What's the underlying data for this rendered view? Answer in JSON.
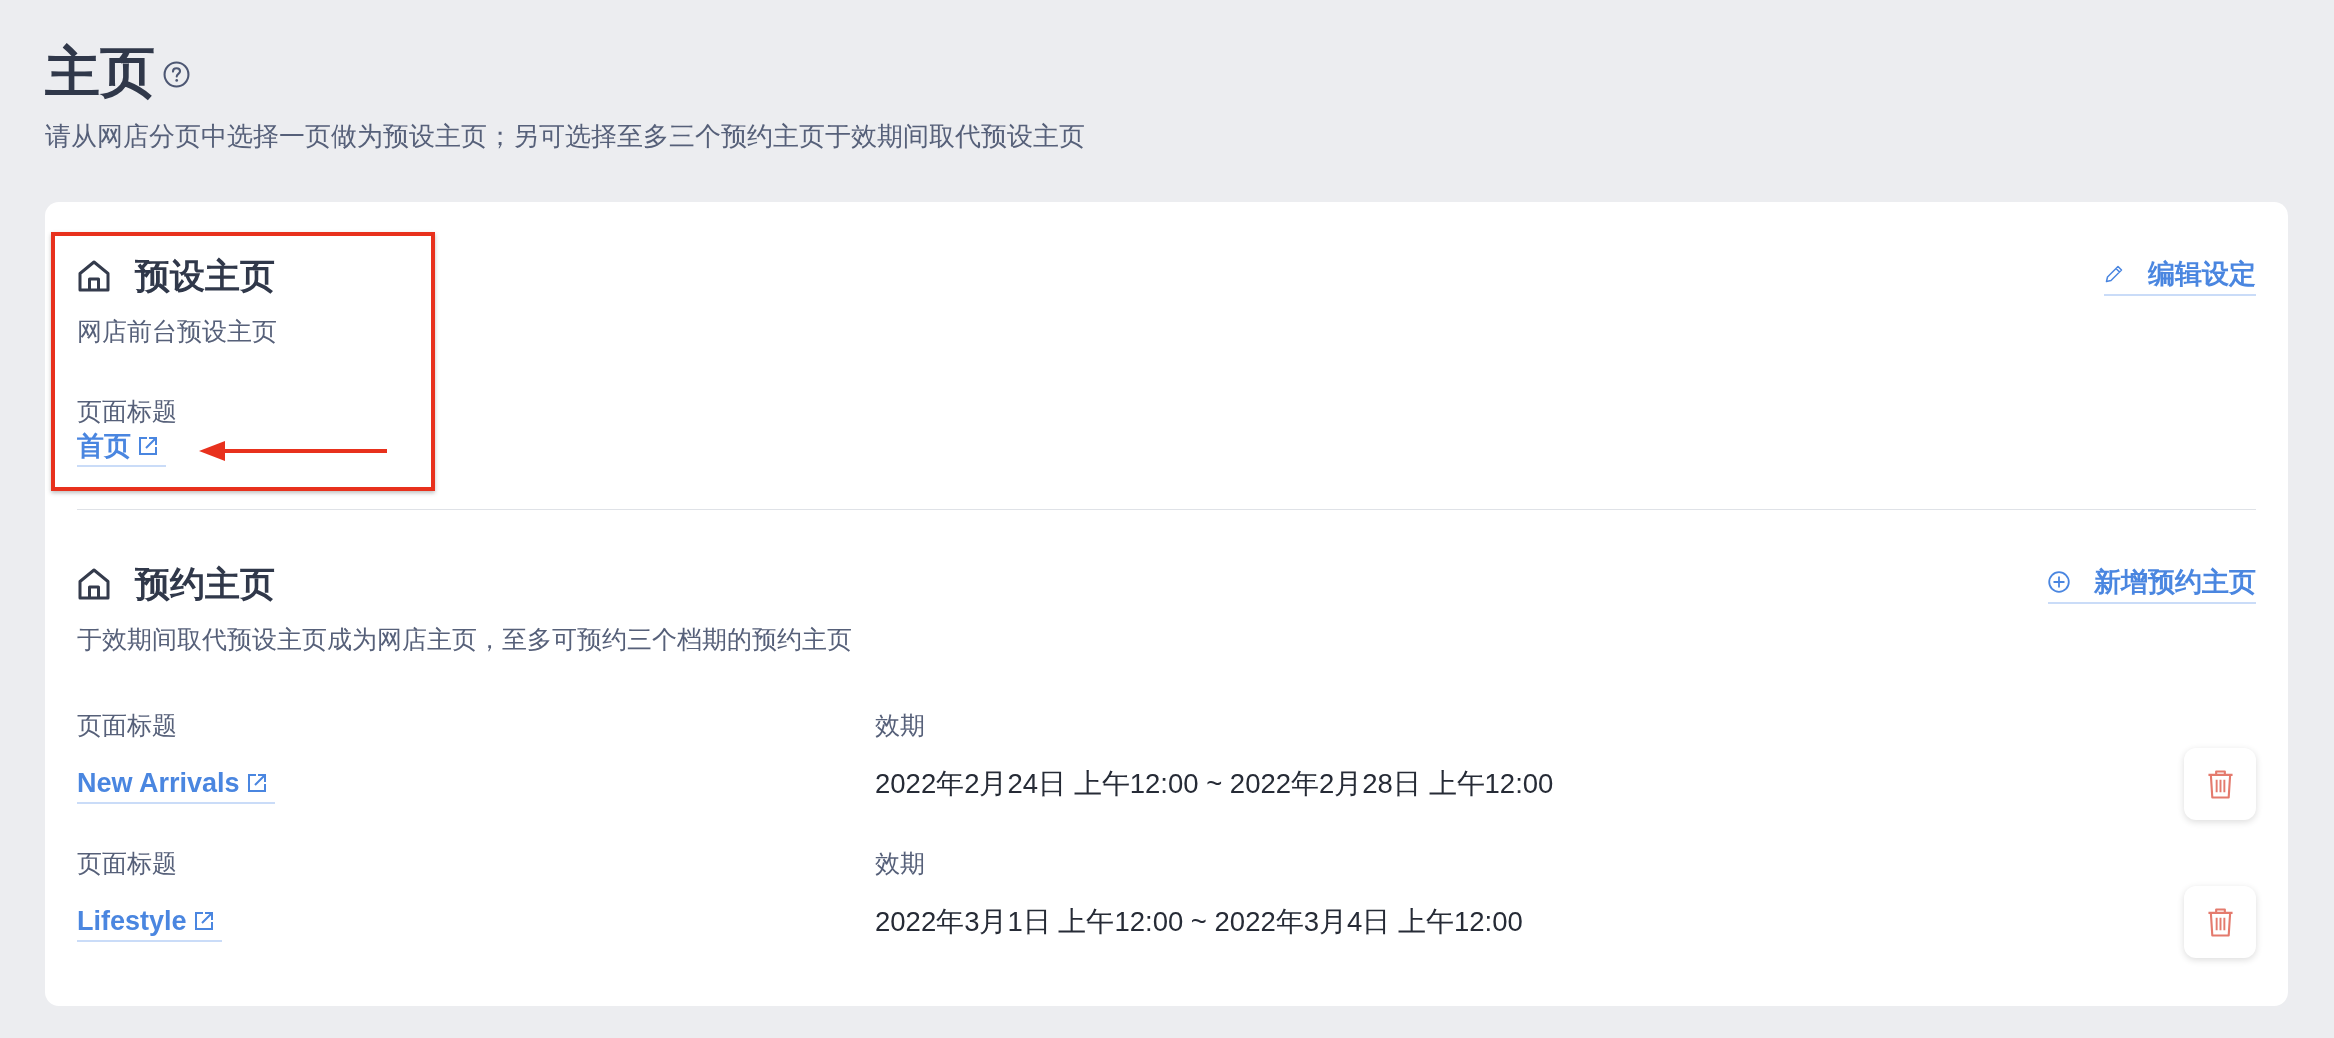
{
  "page": {
    "title": "主页",
    "description": "请从网店分页中选择一页做为预设主页；另可选择至多三个预约主页于效期间取代预设主页"
  },
  "default_homepage": {
    "title": "预设主页",
    "description": "网店前台预设主页",
    "edit_link": "编辑设定",
    "field_label": "页面标题",
    "page_link": "首页",
    "highlighted": true
  },
  "scheduled_homepages": {
    "title": "预约主页",
    "description": "于效期间取代预设主页成为网店主页，至多可预约三个档期的预约主页",
    "add_link": "新增预约主页",
    "rows": [
      {
        "title_label": "页面标题",
        "page_link": "New Arrivals",
        "period_label": "效期",
        "period": "2022年2月24日 上午12:00 ~ 2022年2月28日 上午12:00"
      },
      {
        "title_label": "页面标题",
        "page_link": "Lifestyle",
        "period_label": "效期",
        "period": "2022年3月1日 上午12:00 ~ 2022年3月4日 上午12:00"
      }
    ]
  }
}
